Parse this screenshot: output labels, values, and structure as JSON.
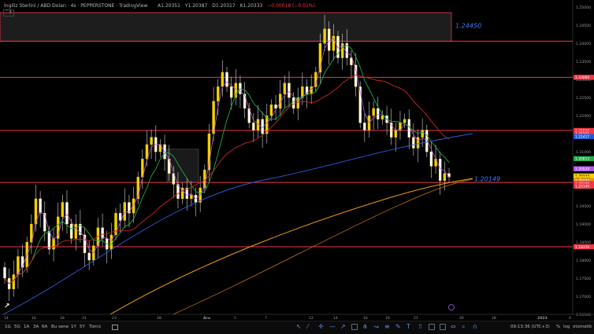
{
  "header": {
    "title": "İngiliz Sterlini / ABD Doları · 4s · PEPPERSTONE · TradingView",
    "ohlc": {
      "open": "A1.20351",
      "high": "Y1.20387",
      "low": "D1.20317",
      "close": "K1.20333",
      "change": "−0.00018 (−0.01%)"
    },
    "collapse_label": "3"
  },
  "chart_data": {
    "type": "candlestick",
    "instrument": "GBPUSD",
    "timeframe": "4s",
    "ylim": [
      1.165,
      1.252
    ],
    "y_ticks": [
      "1.25000",
      "1.24500",
      "1.24000",
      "1.23500",
      "1.23000",
      "1.22500",
      "1.22000",
      "1.21500",
      "1.21000",
      "1.20500",
      "1.20000",
      "1.19500",
      "1.19000",
      "1.18500",
      "1.18000",
      "1.17500",
      "1.17000",
      "1.16500"
    ],
    "x_ticks": [
      "14",
      "16",
      "18",
      "21",
      "23",
      "28",
      "Ara",
      "5",
      "7",
      "12",
      "14",
      "16",
      "19",
      "21",
      "26",
      "28",
      "2023",
      "4"
    ],
    "horizontal_lines": [
      1.2406,
      1.2306,
      1.2159,
      1.2015,
      1.1837
    ],
    "zone_labels": [
      "1.24450",
      "1.20149"
    ],
    "price_tags": [
      {
        "label": "1.23060",
        "color": "#f23645"
      },
      {
        "label": "1.21590",
        "color": "#f23645"
      },
      {
        "label": "1.21521",
        "color": "#f23645"
      },
      {
        "label": "1.21417",
        "color": "#1e5bd8"
      },
      {
        "label": "1.20813",
        "color": "#1faa4a"
      },
      {
        "label": "1.20529",
        "color": "#b259e8"
      },
      {
        "label": "1.20333",
        "color": "#f5d000"
      },
      {
        "label": "03:46:24",
        "color": "#f5d000"
      },
      {
        "label": "1.20277",
        "color": "#e8921c"
      },
      {
        "label": "1.20198",
        "color": "#f23645"
      },
      {
        "label": "1.20149",
        "color": "#f23645"
      },
      {
        "label": "1.18370",
        "color": "#f23645"
      }
    ],
    "candles_close": [
      1.175,
      1.172,
      1.176,
      1.181,
      1.178,
      1.185,
      1.19,
      1.197,
      1.193,
      1.188,
      1.183,
      1.186,
      1.192,
      1.196,
      1.19,
      1.186,
      1.19,
      1.187,
      1.182,
      1.18,
      1.184,
      1.189,
      1.186,
      1.183,
      1.187,
      1.193,
      1.191,
      1.196,
      1.193,
      1.197,
      1.203,
      1.208,
      1.212,
      1.214,
      1.21,
      1.212,
      1.208,
      1.204,
      1.201,
      1.197,
      1.2,
      1.197,
      1.198,
      1.196,
      1.2,
      1.205,
      1.215,
      1.224,
      1.228,
      1.232,
      1.228,
      1.225,
      1.229,
      1.226,
      1.222,
      1.218,
      1.216,
      1.219,
      1.215,
      1.22,
      1.223,
      1.222,
      1.226,
      1.229,
      1.225,
      1.222,
      1.225,
      1.228,
      1.226,
      1.228,
      1.232,
      1.24,
      1.244,
      1.238,
      1.242,
      1.236,
      1.24,
      1.236,
      1.234,
      1.228,
      1.218,
      1.216,
      1.22,
      1.222,
      1.219,
      1.22,
      1.218,
      1.214,
      1.216,
      1.218,
      1.219,
      1.214,
      1.211,
      1.214,
      1.216,
      1.21,
      1.206,
      1.208,
      1.202,
      1.204,
      1.203
    ]
  },
  "bottombar": {
    "timeframes": [
      "1G",
      "5G",
      "1A",
      "3A",
      "6A",
      "Bu sene",
      "1Y",
      "5Y",
      "Tümü"
    ],
    "clock": "09:13:36 (UTC+3)",
    "options": [
      "%",
      "log",
      "otomatik"
    ]
  }
}
